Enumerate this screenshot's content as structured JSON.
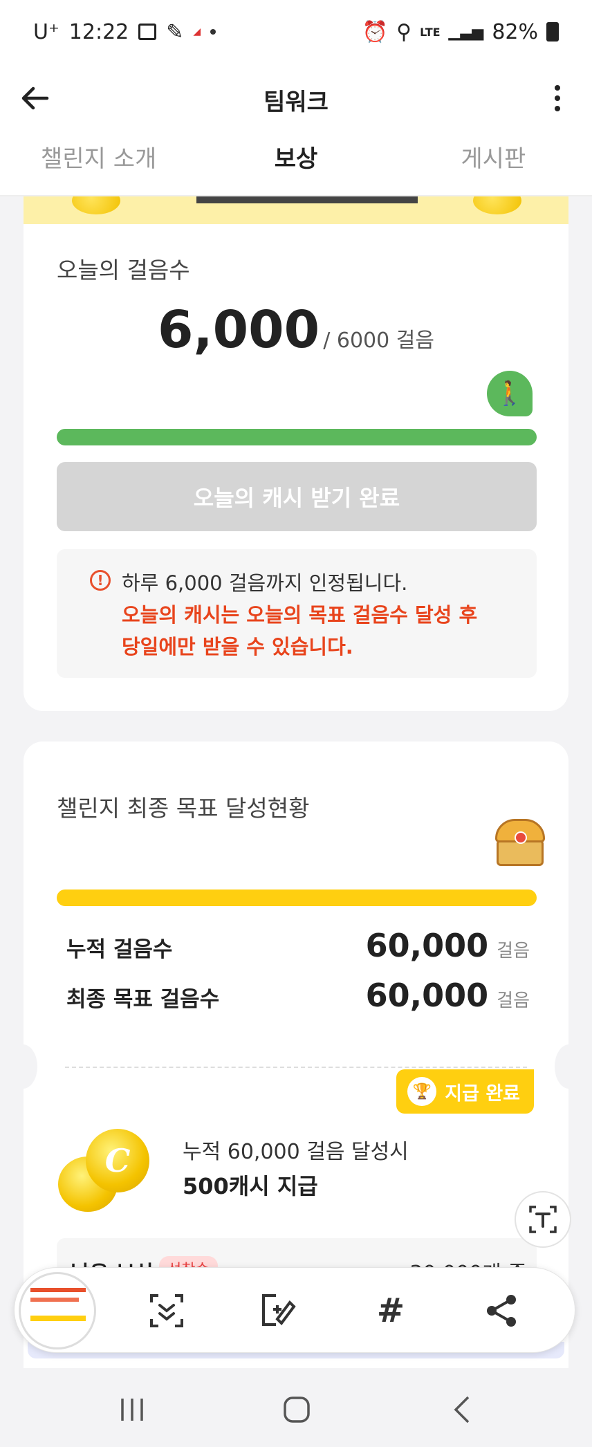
{
  "status_bar": {
    "carrier": "U⁺",
    "time": "12:22",
    "network": "LTE",
    "battery": "82%"
  },
  "app_bar": {
    "title": "팀워크"
  },
  "tabs": [
    {
      "label": "챌린지 소개",
      "active": false
    },
    {
      "label": "보상",
      "active": true
    },
    {
      "label": "게시판",
      "active": false
    }
  ],
  "today": {
    "section_title": "오늘의 걸음수",
    "steps": "6,000",
    "goal": "/ 6000 걸음",
    "progress": 1.0,
    "claim_label": "오늘의 캐시 받기 완료",
    "notice_line1": "하루 6,000 걸음까지 인정됩니다.",
    "notice_line2": "오늘의 캐시는 오늘의 목표 걸음수 달성 후",
    "notice_line3": "당일에만 받을 수 있습니다."
  },
  "final": {
    "section_title": "챌린지 최종 목표 달성현황",
    "progress": 1.0,
    "cumulative_label": "누적 걸음수",
    "cumulative_value": "60,000",
    "target_label": "최종 목표 걸음수",
    "target_value": "60,000",
    "unit": "걸음",
    "paid_label": "지급 완료",
    "reward_line1": "누적 60,000 걸음 달성시",
    "reward_line2": "500캐시 지급",
    "coin_letter": "C"
  },
  "remaining": {
    "label": "남은 보상",
    "tag": "선착순",
    "value": "30,000개 중"
  },
  "colors": {
    "green": "#5cb85c",
    "yellow": "#ffcf10",
    "red": "#e8441c"
  },
  "icons": [
    "back-arrow-icon",
    "more-vert-icon",
    "walker-icon",
    "info-icon",
    "chest-icon",
    "trophy-icon",
    "coin-icon",
    "text-extract-icon",
    "scroll-capture-icon",
    "edit-icon",
    "hashtag-icon",
    "share-icon",
    "recents-icon",
    "home-icon",
    "back-nav-icon"
  ]
}
